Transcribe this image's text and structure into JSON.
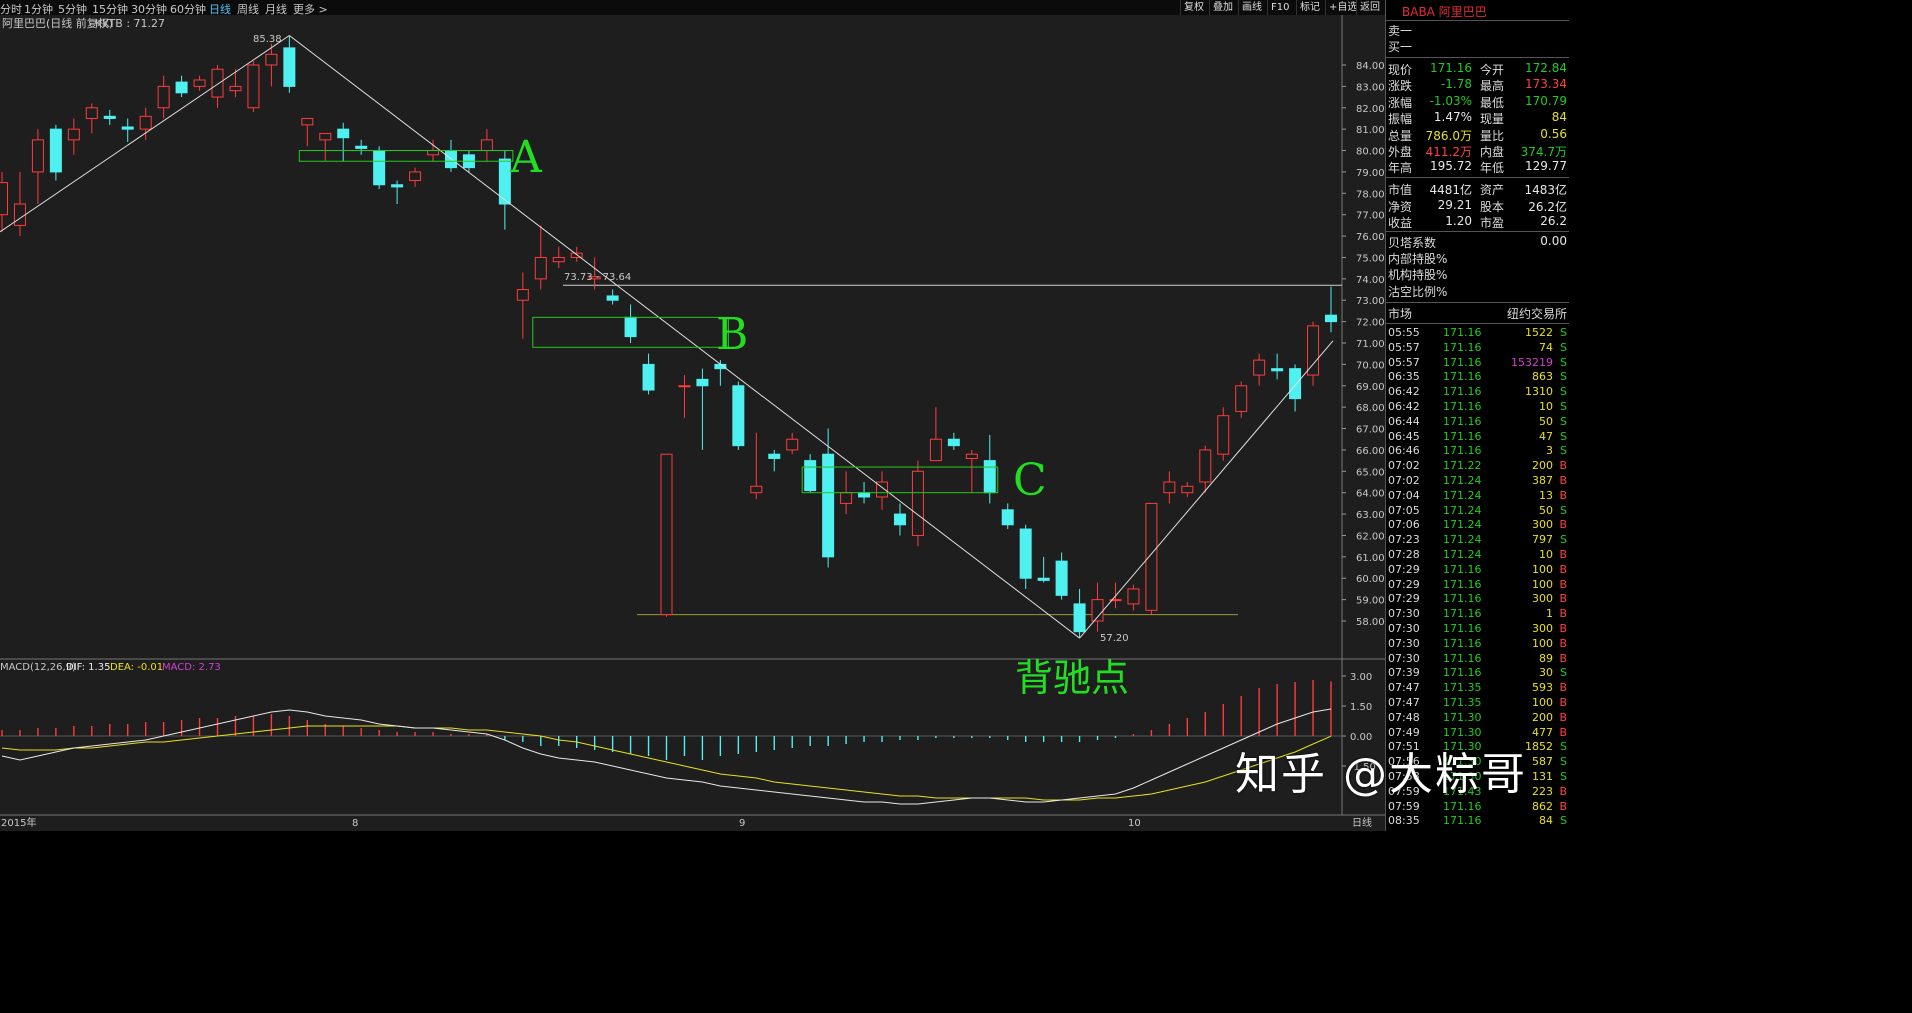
{
  "toolbar": {
    "periods": [
      "分时",
      "1分钟",
      "5分钟",
      "15分钟",
      "30分钟",
      "60分钟",
      "日线",
      "周线",
      "月线",
      "更多 >"
    ],
    "active_period": "日线",
    "buttons": [
      "复权",
      "叠加",
      "画线",
      "F10",
      "标记",
      "+自选",
      "返回"
    ]
  },
  "chart_header": {
    "title": "阿里巴巴(日线 前复权)",
    "indicator": "KKTB : 71.27"
  },
  "price_axis": [
    "84.00",
    "83.00",
    "82.00",
    "81.00",
    "80.00",
    "79.00",
    "78.00",
    "77.00",
    "76.00",
    "75.00",
    "74.00",
    "73.00",
    "72.00",
    "71.00",
    "70.00",
    "69.00",
    "68.00",
    "67.00",
    "66.00",
    "65.00",
    "64.00",
    "63.00",
    "62.00",
    "61.00",
    "60.00",
    "59.00",
    "58.00"
  ],
  "annotations": {
    "high_label": "85.38",
    "low_label": "57.20",
    "range_label": "73.73 - 73.64",
    "zone_a": "A",
    "zone_b": "B",
    "zone_c": "C",
    "divergence": "背驰点"
  },
  "macd": {
    "label": "MACD(12,26,9)",
    "dif": "DIF: 1.35",
    "dea": "DEA: -0.01",
    "macd": "MACD: 2.73",
    "axis": [
      "3.00",
      "1.50",
      "0.00",
      "-1.50"
    ]
  },
  "date_axis": {
    "labels": [
      "2015年",
      "8",
      "9",
      "10"
    ],
    "period_button": "日线"
  },
  "colors": {
    "up": "#ff3b3b",
    "down": "#4ff0f0",
    "zone": "#22cc22",
    "dif": "#e8e8e8",
    "dea": "#e8e020"
  },
  "chart_data": {
    "type": "candlestick",
    "ylim": [
      57,
      86
    ],
    "candles": [
      {
        "o": 77.0,
        "h": 79.0,
        "l": 76.2,
        "c": 78.5
      },
      {
        "o": 76.5,
        "h": 79.0,
        "l": 76.0,
        "c": 77.5
      },
      {
        "o": 79.0,
        "h": 81.0,
        "l": 77.5,
        "c": 80.5
      },
      {
        "o": 81.0,
        "h": 81.2,
        "l": 78.6,
        "c": 79.0
      },
      {
        "o": 80.5,
        "h": 81.5,
        "l": 79.8,
        "c": 81.0
      },
      {
        "o": 81.5,
        "h": 82.2,
        "l": 80.8,
        "c": 82.0
      },
      {
        "o": 81.6,
        "h": 81.9,
        "l": 81.2,
        "c": 81.5
      },
      {
        "o": 81.1,
        "h": 81.5,
        "l": 80.4,
        "c": 81.0
      },
      {
        "o": 81.0,
        "h": 82.0,
        "l": 80.5,
        "c": 81.6
      },
      {
        "o": 82.0,
        "h": 83.5,
        "l": 81.5,
        "c": 83.0
      },
      {
        "o": 83.2,
        "h": 83.5,
        "l": 82.5,
        "c": 82.7
      },
      {
        "o": 83.0,
        "h": 83.5,
        "l": 82.8,
        "c": 83.3
      },
      {
        "o": 82.5,
        "h": 84.0,
        "l": 82.0,
        "c": 83.8
      },
      {
        "o": 82.8,
        "h": 83.8,
        "l": 82.5,
        "c": 83.0
      },
      {
        "o": 82.0,
        "h": 84.2,
        "l": 81.8,
        "c": 84.0
      },
      {
        "o": 84.0,
        "h": 85.0,
        "l": 83.0,
        "c": 84.5
      },
      {
        "o": 84.8,
        "h": 85.38,
        "l": 82.7,
        "c": 83.0
      },
      {
        "o": 81.2,
        "h": 81.5,
        "l": 80.2,
        "c": 81.5
      },
      {
        "o": 80.5,
        "h": 80.8,
        "l": 79.5,
        "c": 80.8
      },
      {
        "o": 81.0,
        "h": 81.3,
        "l": 79.5,
        "c": 80.6
      },
      {
        "o": 80.2,
        "h": 80.5,
        "l": 79.8,
        "c": 80.1
      },
      {
        "o": 80.0,
        "h": 80.2,
        "l": 78.2,
        "c": 78.4
      },
      {
        "o": 78.4,
        "h": 78.6,
        "l": 77.5,
        "c": 78.3
      },
      {
        "o": 78.6,
        "h": 79.2,
        "l": 78.3,
        "c": 79.0
      },
      {
        "o": 79.8,
        "h": 80.5,
        "l": 79.5,
        "c": 80.0
      },
      {
        "o": 80.0,
        "h": 80.5,
        "l": 79.0,
        "c": 79.2
      },
      {
        "o": 79.8,
        "h": 80.0,
        "l": 79.0,
        "c": 79.2
      },
      {
        "o": 80.0,
        "h": 81.0,
        "l": 79.5,
        "c": 80.5
      },
      {
        "o": 79.6,
        "h": 80.0,
        "l": 76.3,
        "c": 77.5
      },
      {
        "o": 73.0,
        "h": 74.3,
        "l": 71.2,
        "c": 73.5
      },
      {
        "o": 74.0,
        "h": 76.5,
        "l": 73.5,
        "c": 75.0
      },
      {
        "o": 74.8,
        "h": 75.5,
        "l": 74.5,
        "c": 75.0
      },
      {
        "o": 75.0,
        "h": 75.5,
        "l": 74.8,
        "c": 75.2
      },
      {
        "o": 74.0,
        "h": 75.0,
        "l": 73.5,
        "c": 74.1
      },
      {
        "o": 73.2,
        "h": 73.5,
        "l": 72.8,
        "c": 73.0
      },
      {
        "o": 72.2,
        "h": 72.8,
        "l": 71.0,
        "c": 71.3
      },
      {
        "o": 70.0,
        "h": 70.5,
        "l": 68.6,
        "c": 68.8
      },
      {
        "o": 58.3,
        "h": 65.8,
        "l": 58.2,
        "c": 65.8
      },
      {
        "o": 69.0,
        "h": 69.5,
        "l": 67.5,
        "c": 69.0
      },
      {
        "o": 69.3,
        "h": 69.8,
        "l": 66.0,
        "c": 69.0
      },
      {
        "o": 70.0,
        "h": 70.2,
        "l": 69.0,
        "c": 69.8
      },
      {
        "o": 69.0,
        "h": 69.2,
        "l": 66.0,
        "c": 66.2
      },
      {
        "o": 64.0,
        "h": 66.8,
        "l": 63.7,
        "c": 64.3
      },
      {
        "o": 65.8,
        "h": 66.0,
        "l": 65.0,
        "c": 65.6
      },
      {
        "o": 66.0,
        "h": 66.8,
        "l": 65.8,
        "c": 66.5
      },
      {
        "o": 65.5,
        "h": 65.8,
        "l": 64.0,
        "c": 64.1
      },
      {
        "o": 65.8,
        "h": 67.0,
        "l": 60.5,
        "c": 61.0
      },
      {
        "o": 63.5,
        "h": 65.0,
        "l": 63.0,
        "c": 64.0
      },
      {
        "o": 64.0,
        "h": 64.5,
        "l": 63.5,
        "c": 63.8
      },
      {
        "o": 63.8,
        "h": 65.0,
        "l": 63.2,
        "c": 64.5
      },
      {
        "o": 63.0,
        "h": 63.5,
        "l": 62.0,
        "c": 62.5
      },
      {
        "o": 62.0,
        "h": 65.5,
        "l": 61.5,
        "c": 65.0
      },
      {
        "o": 65.5,
        "h": 68.0,
        "l": 65.5,
        "c": 66.5
      },
      {
        "o": 66.5,
        "h": 66.8,
        "l": 66.0,
        "c": 66.2
      },
      {
        "o": 65.6,
        "h": 66.0,
        "l": 64.0,
        "c": 65.8
      },
      {
        "o": 65.5,
        "h": 66.7,
        "l": 63.5,
        "c": 64.0
      },
      {
        "o": 63.2,
        "h": 63.5,
        "l": 62.3,
        "c": 62.5
      },
      {
        "o": 62.3,
        "h": 62.5,
        "l": 59.5,
        "c": 60.0
      },
      {
        "o": 60.0,
        "h": 61.0,
        "l": 59.8,
        "c": 59.9
      },
      {
        "o": 60.8,
        "h": 61.2,
        "l": 59.0,
        "c": 59.2
      },
      {
        "o": 58.8,
        "h": 59.5,
        "l": 57.2,
        "c": 57.5
      },
      {
        "o": 58.0,
        "h": 59.8,
        "l": 57.5,
        "c": 59.0
      },
      {
        "o": 59.0,
        "h": 59.8,
        "l": 58.6,
        "c": 59.0
      },
      {
        "o": 58.8,
        "h": 59.7,
        "l": 58.5,
        "c": 59.5
      },
      {
        "o": 58.5,
        "h": 63.5,
        "l": 58.3,
        "c": 63.5
      },
      {
        "o": 64.0,
        "h": 65.0,
        "l": 63.5,
        "c": 64.5
      },
      {
        "o": 64.0,
        "h": 64.5,
        "l": 63.8,
        "c": 64.3
      },
      {
        "o": 64.5,
        "h": 66.2,
        "l": 64.0,
        "c": 66.0
      },
      {
        "o": 65.8,
        "h": 68.0,
        "l": 65.5,
        "c": 67.6
      },
      {
        "o": 67.8,
        "h": 69.2,
        "l": 67.5,
        "c": 69.0
      },
      {
        "o": 69.5,
        "h": 70.5,
        "l": 69.0,
        "c": 70.2
      },
      {
        "o": 69.8,
        "h": 70.5,
        "l": 69.3,
        "c": 69.7
      },
      {
        "o": 69.8,
        "h": 70.0,
        "l": 67.8,
        "c": 68.4
      },
      {
        "o": 69.5,
        "h": 72.0,
        "l": 69.0,
        "c": 71.8
      },
      {
        "o": 72.3,
        "h": 73.64,
        "l": 71.5,
        "c": 72.0
      }
    ],
    "macd_hist": [
      0.3,
      0.3,
      0.4,
      0.4,
      0.5,
      0.5,
      0.6,
      0.6,
      0.7,
      0.7,
      0.8,
      0.9,
      0.9,
      1.0,
      1.0,
      1.1,
      1.0,
      0.8,
      0.6,
      0.5,
      0.4,
      0.3,
      0.2,
      0.2,
      0.2,
      0.1,
      0.1,
      0.1,
      -0.2,
      -0.3,
      -0.5,
      -0.5,
      -0.6,
      -0.7,
      -0.8,
      -0.9,
      -1.0,
      -1.2,
      -1.0,
      -1.2,
      -1.0,
      -0.9,
      -0.8,
      -0.7,
      -0.6,
      -0.5,
      -0.5,
      -0.4,
      -0.3,
      -0.3,
      -0.2,
      -0.2,
      -0.1,
      -0.1,
      -0.1,
      -0.1,
      -0.2,
      -0.3,
      -0.3,
      -0.3,
      -0.3,
      -0.2,
      -0.1,
      0.1,
      0.3,
      0.6,
      0.9,
      1.2,
      1.6,
      2.0,
      2.4,
      2.6,
      2.7,
      2.8,
      2.73
    ],
    "dif": [
      -1.0,
      -1.2,
      -1.0,
      -0.8,
      -0.6,
      -0.5,
      -0.4,
      -0.3,
      -0.2,
      0.0,
      0.2,
      0.4,
      0.6,
      0.8,
      1.0,
      1.2,
      1.3,
      1.2,
      1.0,
      0.9,
      0.8,
      0.6,
      0.5,
      0.4,
      0.4,
      0.3,
      0.2,
      0.1,
      -0.2,
      -0.6,
      -0.9,
      -1.1,
      -1.2,
      -1.3,
      -1.5,
      -1.7,
      -1.9,
      -2.1,
      -2.2,
      -2.3,
      -2.5,
      -2.6,
      -2.7,
      -2.8,
      -2.9,
      -3.0,
      -3.1,
      -3.2,
      -3.3,
      -3.3,
      -3.4,
      -3.4,
      -3.3,
      -3.2,
      -3.1,
      -3.1,
      -3.2,
      -3.3,
      -3.3,
      -3.2,
      -3.1,
      -3.0,
      -2.9,
      -2.6,
      -2.2,
      -1.8,
      -1.4,
      -1.0,
      -0.6,
      -0.2,
      0.2,
      0.6,
      0.9,
      1.2,
      1.35
    ],
    "dea": [
      -0.6,
      -0.7,
      -0.7,
      -0.7,
      -0.6,
      -0.6,
      -0.5,
      -0.4,
      -0.3,
      -0.3,
      -0.2,
      -0.1,
      0.0,
      0.1,
      0.2,
      0.3,
      0.4,
      0.5,
      0.5,
      0.5,
      0.5,
      0.5,
      0.5,
      0.4,
      0.4,
      0.4,
      0.3,
      0.3,
      0.2,
      0.1,
      0.0,
      -0.2,
      -0.3,
      -0.5,
      -0.7,
      -0.9,
      -1.1,
      -1.3,
      -1.5,
      -1.7,
      -1.9,
      -2.0,
      -2.1,
      -2.3,
      -2.4,
      -2.5,
      -2.6,
      -2.7,
      -2.8,
      -2.9,
      -3.0,
      -3.0,
      -3.1,
      -3.1,
      -3.1,
      -3.1,
      -3.1,
      -3.1,
      -3.2,
      -3.2,
      -3.2,
      -3.1,
      -3.1,
      -3.0,
      -2.9,
      -2.7,
      -2.5,
      -2.3,
      -2.0,
      -1.7,
      -1.4,
      -1.1,
      -0.8,
      -0.4,
      -0.01
    ]
  },
  "panel": {
    "title": "BABA 阿里巴巴",
    "sell1": "卖一",
    "buy1": "买一",
    "quote_rows": [
      {
        "l1": "现价",
        "v1": "171.16",
        "c1": "green",
        "l2": "今开",
        "v2": "172.84",
        "c2": "green"
      },
      {
        "l1": "涨跌",
        "v1": "-1.78",
        "c1": "green",
        "l2": "最高",
        "v2": "173.34",
        "c2": "red"
      },
      {
        "l1": "涨幅",
        "v1": "-1.03%",
        "c1": "green",
        "l2": "最低",
        "v2": "170.79",
        "c2": "green"
      },
      {
        "l1": "振幅",
        "v1": "1.47%",
        "c1": "white",
        "l2": "现量",
        "v2": "84",
        "c2": "yellow"
      },
      {
        "l1": "总量",
        "v1": "786.0万",
        "c1": "yellow",
        "l2": "量比",
        "v2": "0.56",
        "c2": "yellow"
      },
      {
        "l1": "外盘",
        "v1": "411.2万",
        "c1": "red",
        "l2": "内盘",
        "v2": "374.7万",
        "c2": "green"
      },
      {
        "l1": "年高",
        "v1": "195.72",
        "c1": "white",
        "l2": "年低",
        "v2": "129.77",
        "c2": "white"
      }
    ],
    "fin_rows": [
      {
        "l1": "市值",
        "v1": "4481亿",
        "l2": "资产",
        "v2": "1483亿"
      },
      {
        "l1": "净资",
        "v1": "29.21",
        "l2": "股本",
        "v2": "26.2亿"
      },
      {
        "l1": "收益",
        "v1": "1.20",
        "l2": "市盈",
        "v2": "26.2"
      }
    ],
    "beta_label": "贝塔系数",
    "beta_value": "0.00",
    "holding_labels": [
      "内部持股%",
      "机构持股%",
      "沽空比例%"
    ],
    "market_label": "市场",
    "market_value": "纽约交易所",
    "ticks": [
      {
        "t": "05:55",
        "p": "171.16",
        "v": "1522",
        "s": "S",
        "vc": "yellow"
      },
      {
        "t": "05:57",
        "p": "171.16",
        "v": "74",
        "s": "S",
        "vc": "yellow"
      },
      {
        "t": "05:57",
        "p": "171.16",
        "v": "153219",
        "s": "S",
        "vc": "magenta"
      },
      {
        "t": "06:35",
        "p": "171.16",
        "v": "863",
        "s": "S",
        "vc": "yellow"
      },
      {
        "t": "06:42",
        "p": "171.16",
        "v": "1310",
        "s": "S",
        "vc": "yellow"
      },
      {
        "t": "06:42",
        "p": "171.16",
        "v": "10",
        "s": "S",
        "vc": "yellow"
      },
      {
        "t": "06:44",
        "p": "171.16",
        "v": "50",
        "s": "S",
        "vc": "yellow"
      },
      {
        "t": "06:45",
        "p": "171.16",
        "v": "47",
        "s": "S",
        "vc": "yellow"
      },
      {
        "t": "06:46",
        "p": "171.16",
        "v": "3",
        "s": "S",
        "vc": "yellow"
      },
      {
        "t": "07:02",
        "p": "171.22",
        "v": "200",
        "s": "B",
        "vc": "yellow"
      },
      {
        "t": "07:02",
        "p": "171.24",
        "v": "387",
        "s": "B",
        "vc": "yellow"
      },
      {
        "t": "07:04",
        "p": "171.24",
        "v": "13",
        "s": "B",
        "vc": "yellow"
      },
      {
        "t": "07:05",
        "p": "171.24",
        "v": "50",
        "s": "S",
        "vc": "yellow"
      },
      {
        "t": "07:06",
        "p": "171.24",
        "v": "300",
        "s": "B",
        "vc": "yellow"
      },
      {
        "t": "07:23",
        "p": "171.24",
        "v": "797",
        "s": "S",
        "vc": "yellow"
      },
      {
        "t": "07:28",
        "p": "171.24",
        "v": "10",
        "s": "B",
        "vc": "yellow"
      },
      {
        "t": "07:29",
        "p": "171.16",
        "v": "100",
        "s": "B",
        "vc": "yellow"
      },
      {
        "t": "07:29",
        "p": "171.16",
        "v": "100",
        "s": "B",
        "vc": "yellow"
      },
      {
        "t": "07:29",
        "p": "171.16",
        "v": "300",
        "s": "B",
        "vc": "yellow"
      },
      {
        "t": "07:30",
        "p": "171.16",
        "v": "1",
        "s": "B",
        "vc": "yellow"
      },
      {
        "t": "07:30",
        "p": "171.16",
        "v": "300",
        "s": "B",
        "vc": "yellow"
      },
      {
        "t": "07:30",
        "p": "171.16",
        "v": "100",
        "s": "B",
        "vc": "yellow"
      },
      {
        "t": "07:30",
        "p": "171.16",
        "v": "89",
        "s": "B",
        "vc": "yellow"
      },
      {
        "t": "07:39",
        "p": "171.16",
        "v": "30",
        "s": "S",
        "vc": "yellow"
      },
      {
        "t": "07:47",
        "p": "171.35",
        "v": "593",
        "s": "B",
        "vc": "yellow"
      },
      {
        "t": "07:47",
        "p": "171.35",
        "v": "100",
        "s": "B",
        "vc": "yellow"
      },
      {
        "t": "07:48",
        "p": "171.30",
        "v": "200",
        "s": "B",
        "vc": "yellow"
      },
      {
        "t": "07:49",
        "p": "171.30",
        "v": "477",
        "s": "B",
        "vc": "yellow"
      },
      {
        "t": "07:51",
        "p": "171.30",
        "v": "1852",
        "s": "S",
        "vc": "yellow"
      },
      {
        "t": "07:56",
        "p": "171.30",
        "v": "587",
        "s": "S",
        "vc": "yellow"
      },
      {
        "t": "07:58",
        "p": "171.30",
        "v": "131",
        "s": "S",
        "vc": "yellow"
      },
      {
        "t": "07:59",
        "p": "171.43",
        "v": "223",
        "s": "B",
        "vc": "yellow"
      },
      {
        "t": "07:59",
        "p": "171.16",
        "v": "862",
        "s": "B",
        "vc": "yellow"
      },
      {
        "t": "08:35",
        "p": "171.16",
        "v": "84",
        "s": "S",
        "vc": "yellow"
      }
    ]
  },
  "watermark": "知乎 @大粽哥"
}
